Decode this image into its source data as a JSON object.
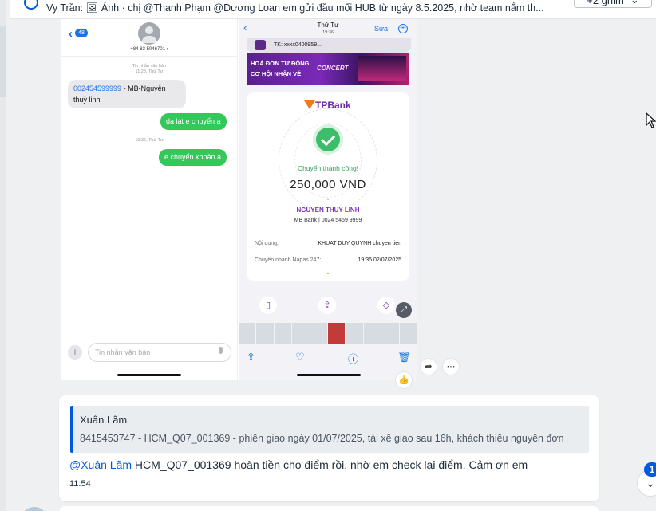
{
  "reply_bar": {
    "text": "Vy Trần: 🖼 Ảnh · chị @Thanh Phạm @Dương Loan em gửi đầu mối HUB từ ngày 8.5.2025, nhờ team nắm th...",
    "members_label": "+2 ghim"
  },
  "image_message": {
    "imessage": {
      "back_count": "48",
      "phone": "+84 83 5046701 ›",
      "ts1_line1": "Tin nhắn văn bản",
      "ts1_line2": "11:28, Thứ Tư",
      "incoming_link": "002454599999",
      "incoming_text": " - MB-Nguyễn thuỳ linh",
      "out1": "dạ lát e chuyển ạ",
      "ts2": "19:36, Thứ Tư",
      "out2": "e chuyển khoản ạ",
      "compose_placeholder": "Tin nhắn văn bản"
    },
    "bank": {
      "header_title": "Thứ Tư",
      "header_time": "19:36",
      "edit_label": "Sửa",
      "account": "TK: xxxx0400959...",
      "promo_line1": "HOÁ ĐƠN TỰ ĐỘNG",
      "promo_line2": "CƠ HỘI NHẬN VÉ",
      "promo_line3": "CONCERT",
      "bank_logo": "TPBank",
      "status": "Chuyển thành công!",
      "amount": "250,000 VND",
      "recipient": "NGUYEN THUY LINH",
      "recipient_bank": "MB Bank  |  0024 5459 9999",
      "content_label": "Nội dung:",
      "content_value": "KHUAT DUY QUYNH chuyen tien",
      "transfer_label": "Chuyển nhanh Napas 247:",
      "transfer_value": "19:35 02/07/2025"
    }
  },
  "quoted_message": {
    "author": "Xuân Lãm",
    "text": "8415453747 - HCM_Q07_001369 - phiên giao ngày 01/07/2025, tài xế giao sau 16h, khách thiếu nguyên đơn"
  },
  "message": {
    "mention": "@Xuân Lãm",
    "text": " HCM_Q07_001369   hoàn tiền cho điểm rồi, nhờ em check lại điểm. Cảm ơn em",
    "time": "11:54"
  },
  "unread_count": "1",
  "colors": {
    "accent": "#005ae0",
    "imessage_green": "#34c759",
    "tpbank_purple": "#6b2a9e"
  }
}
